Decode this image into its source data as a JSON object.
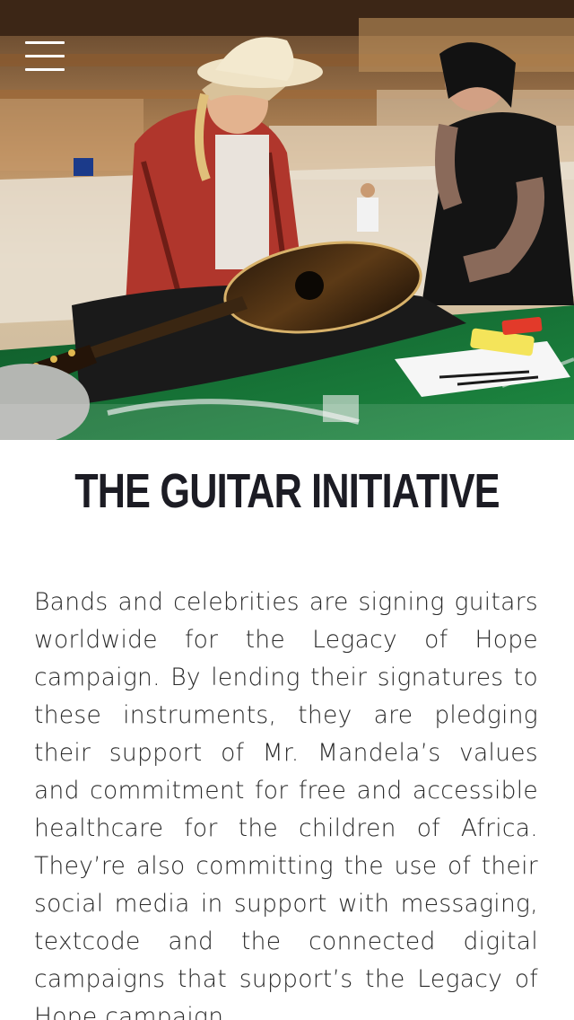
{
  "header": {
    "menu_icon": "hamburger-menu-icon"
  },
  "hero": {
    "image_description_icon": "photo"
  },
  "article": {
    "title": "THE GUITAR INITIATIVE",
    "body": "Bands and celebrities are signing guitars worldwide for the Legacy of Hope campaign. By lending their signatures to these instruments, they are pledging their support of Mr. Mandela’s values and commitment for free and accessible healthcare for the children of Africa. They’re also committing the use of their social media in support with messaging, textcode and the connected digital campaigns that support’s the Legacy of Hope campaign."
  },
  "colors": {
    "title": "#1c1c24",
    "body_text": "#2a2a2a",
    "background": "#ffffff",
    "table_green": "#1e7a3a"
  }
}
